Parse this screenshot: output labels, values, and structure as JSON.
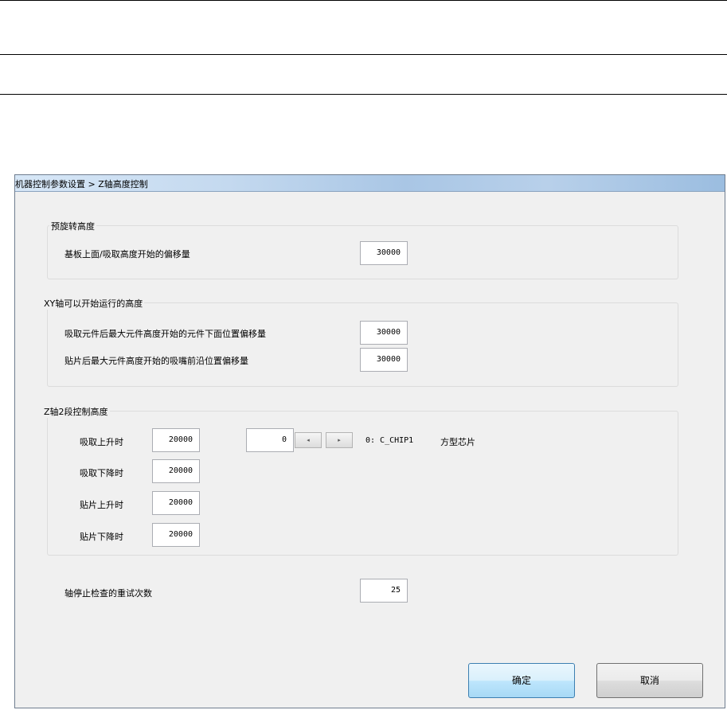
{
  "window": {
    "title": "机器控制参数设置 > Z轴高度控制"
  },
  "group_prerotate": {
    "title": "预旋转高度",
    "rows": [
      {
        "label": "基板上面/吸取高度开始的偏移量",
        "value": "30000"
      }
    ]
  },
  "group_xy": {
    "title": "XY轴可以开始运行的高度",
    "rows": [
      {
        "label": "吸取元件后最大元件高度开始的元件下面位置偏移量",
        "value": "30000"
      },
      {
        "label": "贴片后最大元件高度开始的吸嘴前沿位置偏移量",
        "value": "30000"
      }
    ]
  },
  "group_z2": {
    "title": "Z轴2段控制高度",
    "rows": [
      {
        "label": "吸取上升时",
        "value": "20000"
      },
      {
        "label": "吸取下降时",
        "value": "20000"
      },
      {
        "label": "贴片上升时",
        "value": "20000"
      },
      {
        "label": "贴片下降时",
        "value": "20000"
      }
    ],
    "part_index": "0",
    "part_code": "0: C_CHIP1",
    "part_name": "方型芯片",
    "prev_glyph": "◂",
    "next_glyph": "▸"
  },
  "retry": {
    "label": "轴停止检查的重试次数",
    "value": "25"
  },
  "buttons": {
    "ok": "确定",
    "cancel": "取消"
  }
}
